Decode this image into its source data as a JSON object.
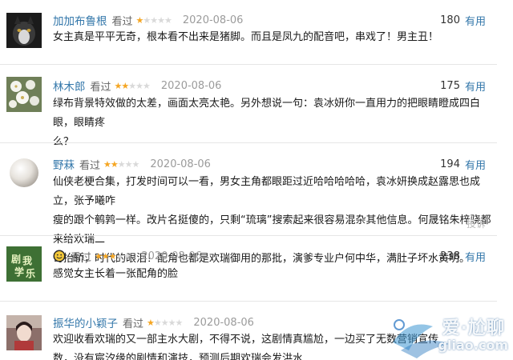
{
  "reviews": [
    {
      "user": "加加布鲁根",
      "status": "看过",
      "stars_filled": 1,
      "stars_total": 5,
      "date": "2020-08-06",
      "votes": "180",
      "useful_label": "有用",
      "content": "女主真是平平无奇，根本看不出来是猪脚。而且是凤九的配音吧，串戏了！男主丑！",
      "avatar": "dark-animal-photo"
    },
    {
      "user": "林木郎",
      "status": "看过",
      "stars_filled": 2,
      "stars_total": 5,
      "date": "2020-08-06",
      "votes": "175",
      "useful_label": "有用",
      "content": "绿布背景特效做的太差，画面太亮太艳。另外想说一句：袁冰妍你一直用力的把眼睛瞪成四白眼，眼睛疼\n么？",
      "avatar": "white-flowers-photo"
    },
    {
      "user": "野菻",
      "status": "看过",
      "stars_filled": 2,
      "stars_total": 5,
      "date": "2020-08-06",
      "votes": "194",
      "useful_label": "有用",
      "content": "仙侠老梗合集，打发时间可以一看，男女主角都眼距过近哈哈哈哈哈，袁冰妍换成赵露思也成立，张予曦咋\n瘦的跟个鹌鹑一样。改片名挺傻的，只剩“琉璃”搜索起来很容易混杂其他信息。何晟铭朱梓骁都来给欢瑞二\n哥抬轿，时代的眼泪！配角也都是欢瑞御用的那批，演爹专业户何中华，满肚子坏水黄明。",
      "report_label": "投诉",
      "avatar": "pearl-photo"
    },
    {
      "user": "",
      "status": "看过",
      "stars_filled": 3,
      "stars_total": 5,
      "date": "2020-08-06",
      "votes": "238",
      "useful_label": "有用",
      "content": "感觉女主长着一张配角的脸",
      "avatar": "green-text-logo",
      "avatar_text": "剧\n我\n学\n乐",
      "badge_icon": "smiley-icon"
    },
    {
      "user": "振华的小颖子",
      "status": "看过",
      "stars_filled": 1,
      "stars_total": 5,
      "date": "2020-08-06",
      "votes": "",
      "useful_label": "",
      "content": "欢迎收看欢瑞的又一部主水大剧，不得不说，这剧情真尴尬，一边买了无数营销宣传\n数，没有宸汐缘的剧情和演技，预测后期欢瑞会发洪水",
      "avatar": "portrait-photo"
    }
  ],
  "watermark": {
    "text": "爱·尬聊",
    "url": "gliao.com"
  },
  "colors": {
    "link": "#3377aa",
    "star_on": "#f5a623",
    "star_off": "#d9d9d9",
    "date": "#9b9b9b"
  }
}
